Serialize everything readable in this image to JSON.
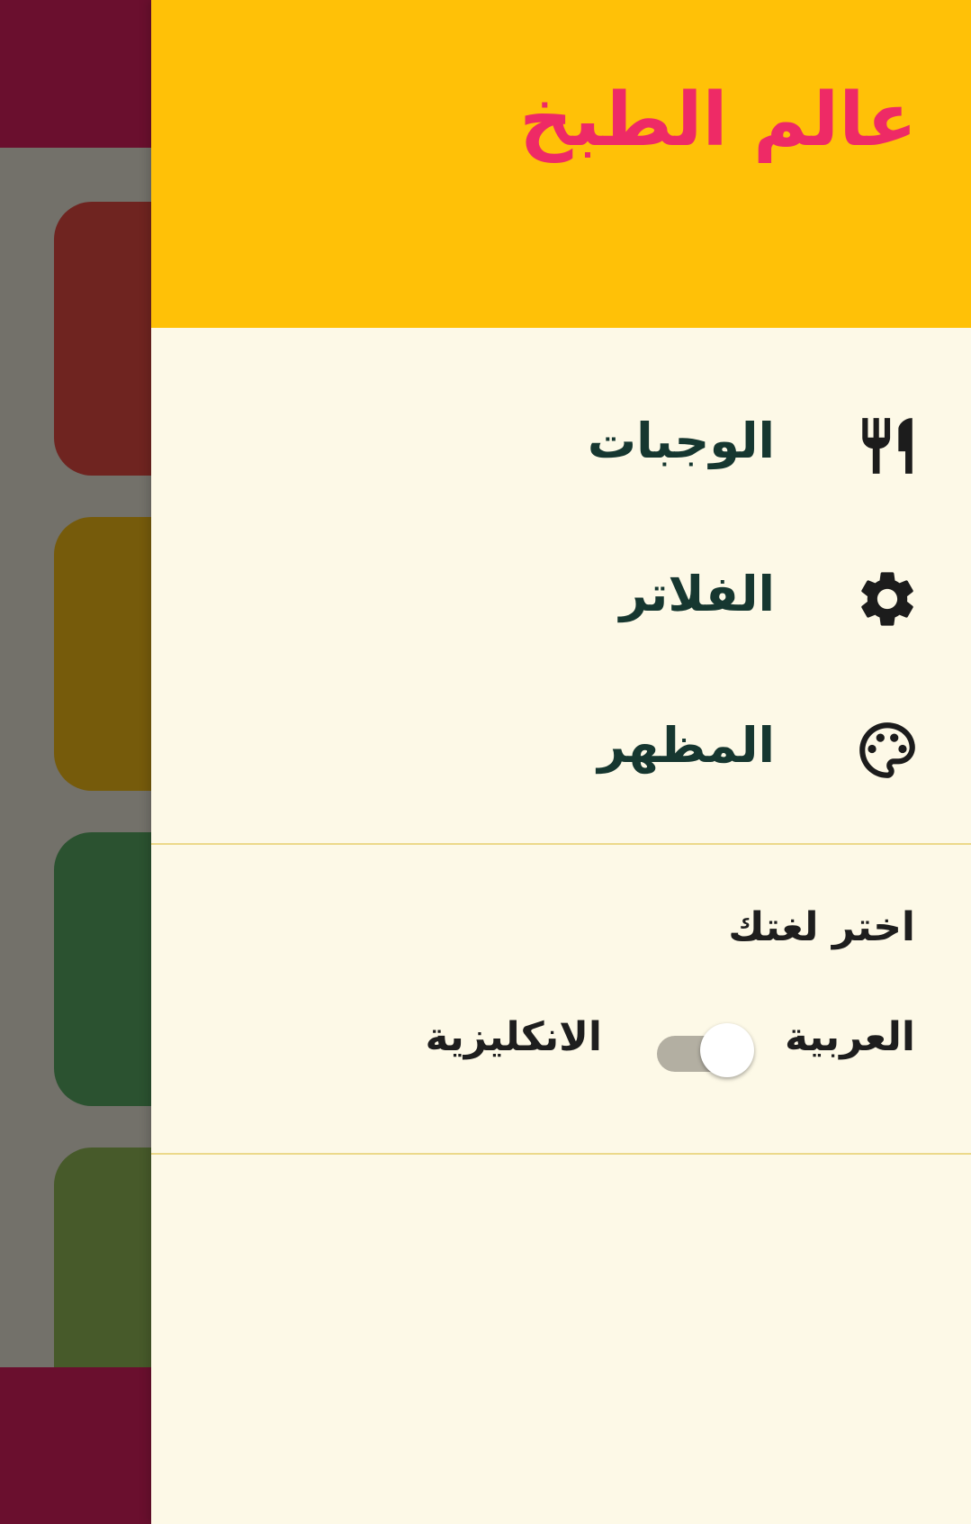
{
  "colors": {
    "drawer_header": "#ffc107",
    "drawer_title": "#ee2a66",
    "drawer_bg": "#fdf9e7",
    "app_bar": "#6a0f2e",
    "menu_text": "#163730"
  },
  "drawer": {
    "title": "عالم الطبخ",
    "items": [
      {
        "label": "الوجبات",
        "icon": "restaurant-icon"
      },
      {
        "label": "الفلاتر",
        "icon": "gear-icon"
      },
      {
        "label": "المظهر",
        "icon": "palette-icon"
      }
    ]
  },
  "language": {
    "title": "اختر لغتك",
    "option_right": "العربية",
    "option_left": "الانكليزية",
    "switch_on": true
  }
}
